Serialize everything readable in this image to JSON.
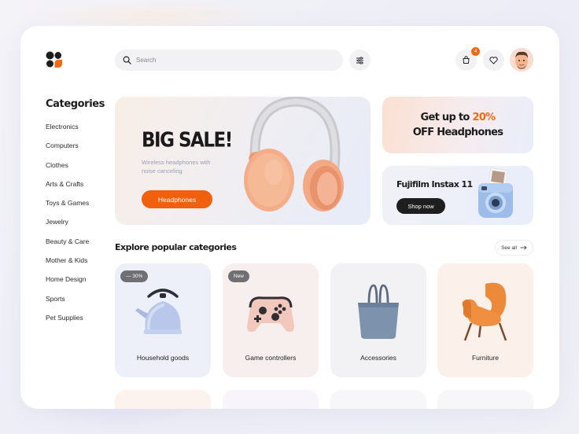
{
  "search": {
    "placeholder": "Search"
  },
  "header": {
    "cart_count": "4"
  },
  "sidebar": {
    "title": "Categories",
    "items": [
      "Electronics",
      "Computers",
      "Clothes",
      "Arts & Crafts",
      "Toys & Games",
      "Jewelry",
      "Beauty & Care",
      "Mother & Kids",
      "Home Design",
      "Sports",
      "Pet Supplies"
    ]
  },
  "hero": {
    "title": "BIG SALE!",
    "subtitle": "Wireless headphones with noise canceling",
    "button_label": "Headphones"
  },
  "promo1": {
    "line1_pre": "Get up to ",
    "line1_highlight": "20%",
    "line2": "OFF Headphones"
  },
  "promo2": {
    "title": "Fujifilm Instax 11",
    "button_label": "Shop now"
  },
  "explore": {
    "title": "Explore popular categories",
    "see_all_label": "See all",
    "tiles": [
      {
        "label": "Household goods",
        "tag": "— 30%"
      },
      {
        "label": "Game controllers",
        "tag": "New"
      },
      {
        "label": "Accessories"
      },
      {
        "label": "Furniture"
      }
    ]
  },
  "colors": {
    "accent": "#f06a16",
    "dark": "#1c1c1c"
  },
  "icons": [
    "logo-icon",
    "search-icon",
    "filter-icon",
    "cart-icon",
    "heart-icon",
    "arrow-right-icon"
  ]
}
